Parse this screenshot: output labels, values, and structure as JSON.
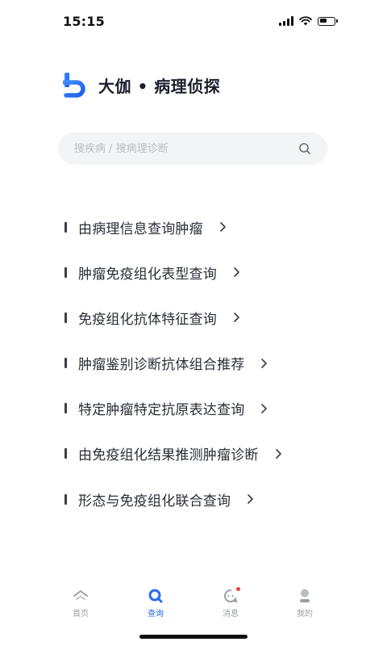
{
  "status_bar": {
    "time": "15:15"
  },
  "brand": {
    "name": "大伽 • 病理侦探",
    "logo_color": "#2a6af2"
  },
  "search": {
    "placeholder": "搜疾病 / 搜病理诊断",
    "value": ""
  },
  "menu": {
    "items": [
      {
        "label": "由病理信息查询肿瘤"
      },
      {
        "label": "肿瘤免疫组化表型查询"
      },
      {
        "label": "免疫组化抗体特征查询"
      },
      {
        "label": "肿瘤鉴别诊断抗体组合推荐"
      },
      {
        "label": "特定肿瘤特定抗原表达查询"
      },
      {
        "label": "由免疫组化结果推测肿瘤诊断"
      },
      {
        "label": "形态与免疫组化联合查询"
      }
    ]
  },
  "tab_bar": {
    "active_color": "#2a6af2",
    "inactive_color": "#9a9ea6",
    "tabs": [
      {
        "label": "首页",
        "icon": "home-icon",
        "active": false
      },
      {
        "label": "查询",
        "icon": "search-icon",
        "active": true
      },
      {
        "label": "消息",
        "icon": "message-icon",
        "active": false,
        "badge": true
      },
      {
        "label": "我的",
        "icon": "profile-icon",
        "active": false
      }
    ]
  }
}
